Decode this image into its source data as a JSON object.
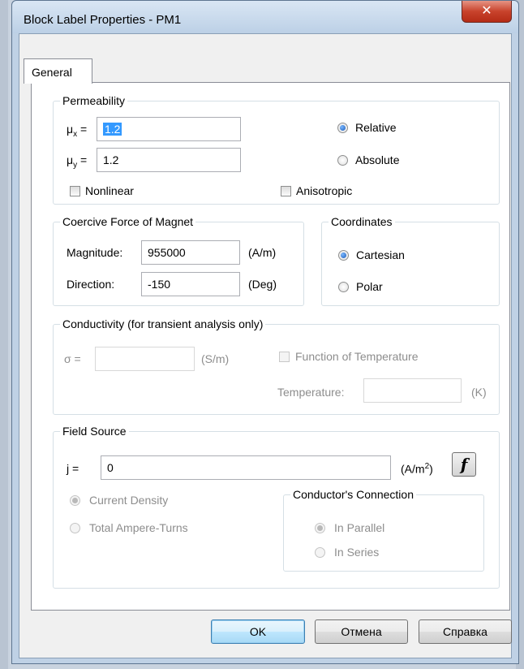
{
  "window": {
    "title": "Block Label Properties - PM1",
    "close_icon": "close-icon"
  },
  "tabs": [
    {
      "label": "General",
      "active": true
    }
  ],
  "permeability": {
    "legend": "Permeability",
    "mux_label": "μx =",
    "mux_value": "1.2",
    "muy_label": "μy =",
    "muy_value": "1.2",
    "relative_label": "Relative",
    "absolute_label": "Absolute",
    "selected_mode": "Relative",
    "nonlinear_label": "Nonlinear",
    "nonlinear_checked": false,
    "anisotropic_label": "Anisotropic",
    "anisotropic_checked": false
  },
  "coercive": {
    "legend": "Coercive Force of Magnet",
    "magnitude_label": "Magnitude:",
    "magnitude_value": "955000",
    "magnitude_unit": "(A/m)",
    "direction_label": "Direction:",
    "direction_value": "-150",
    "direction_unit": "(Deg)"
  },
  "coordinates": {
    "legend": "Coordinates",
    "cartesian_label": "Cartesian",
    "polar_label": "Polar",
    "selected": "Cartesian"
  },
  "conductivity": {
    "legend": "Conductivity (for transient analysis only)",
    "sigma_label": "σ =",
    "sigma_value": "",
    "sigma_unit": "(S/m)",
    "function_label": "Function of Temperature",
    "function_checked": false,
    "temperature_label": "Temperature:",
    "temperature_value": "",
    "temperature_unit": "(K)",
    "enabled": false
  },
  "field_source": {
    "legend": "Field Source",
    "j_label": "j =",
    "j_value": "0",
    "j_unit": "(A/m",
    "j_unit_exp": "2",
    "j_unit_close": ")",
    "f_button_label": "f",
    "current_density_label": "Current Density",
    "total_ampere_turns_label": "Total Ampere-Turns",
    "selected": "Current Density",
    "connection": {
      "legend": "Conductor's Connection",
      "parallel_label": "In Parallel",
      "series_label": "In Series",
      "selected": "In Parallel"
    }
  },
  "buttons": {
    "ok": "OK",
    "cancel": "Отмена",
    "help": "Справка"
  }
}
